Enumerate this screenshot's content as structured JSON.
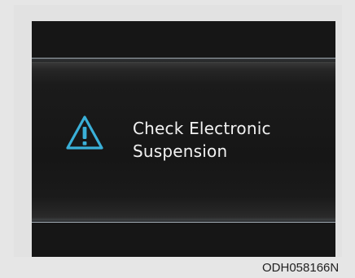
{
  "display": {
    "message_line1": "Check Electronic",
    "message_line2": "Suspension",
    "icon": "warning-triangle-icon",
    "icon_color": "#3ab0d8",
    "text_color": "#f2f2f2",
    "screen_color": "#161616"
  },
  "figure": {
    "code": "ODH058166N"
  }
}
